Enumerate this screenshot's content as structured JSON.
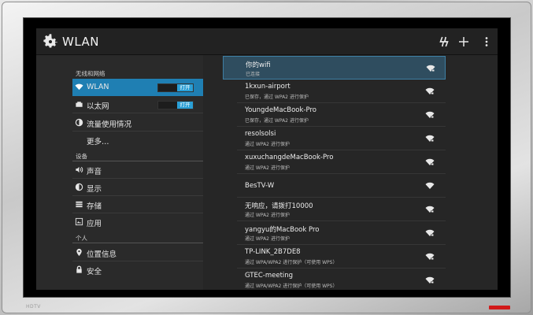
{
  "window": {
    "title": "WLAN"
  },
  "device": {
    "brand_label": "HDTV"
  },
  "toolbar": {
    "icons": [
      "gear-icon",
      "wps-icon",
      "add-icon",
      "overflow-menu-icon"
    ]
  },
  "sidebar": {
    "wireless_header": "无线和网络",
    "device_header": "设备",
    "personal_header": "个人",
    "items": [
      {
        "label": "WLAN",
        "icon": "wifi-icon",
        "toggle": "打开",
        "selected": true
      },
      {
        "label": "以太网",
        "icon": "ethernet-icon",
        "toggle": "打开"
      },
      {
        "label": "流量使用情况",
        "icon": "data-usage-icon"
      },
      {
        "label": "更多…",
        "icon": ""
      },
      {
        "label": "声音",
        "icon": "volume-icon"
      },
      {
        "label": "显示",
        "icon": "display-icon"
      },
      {
        "label": "存储",
        "icon": "storage-icon"
      },
      {
        "label": "应用",
        "icon": "apps-icon"
      },
      {
        "label": "位置信息",
        "icon": "location-icon"
      },
      {
        "label": "安全",
        "icon": "lock-icon"
      }
    ]
  },
  "networks": [
    {
      "ssid": "你的wifi",
      "status": "已连接",
      "selected": true
    },
    {
      "ssid": "1kxun-airport",
      "status": "已保存，通过 WPA2 进行保护"
    },
    {
      "ssid": "YoungdeMacBook-Pro",
      "status": "已保存，通过 WPA2 进行保护"
    },
    {
      "ssid": "resolsolsi",
      "status": "通过 WPA2 进行保护"
    },
    {
      "ssid": "xuxuchangdeMacBook-Pro",
      "status": "通过 WPA2 进行保护"
    },
    {
      "ssid": "BesTV-W",
      "status": ""
    },
    {
      "ssid": "无响应，请拨打10000",
      "status": "通过 WPA2 进行保护"
    },
    {
      "ssid": "yangyu的MacBook Pro",
      "status": "通过 WPA2 进行保护"
    },
    {
      "ssid": "TP-LINK_2B7DE8",
      "status": "通过 WPA/WPA2 进行保护（可使用 WPS）"
    },
    {
      "ssid": "GTEC-meeting",
      "status": "通过 WPA/WPA2 进行保护（可使用 WPS）"
    }
  ],
  "colors": {
    "accent": "#1f7fb3",
    "selected_network": "#2f4d5f",
    "toggle_on": "#2a9fd6"
  }
}
